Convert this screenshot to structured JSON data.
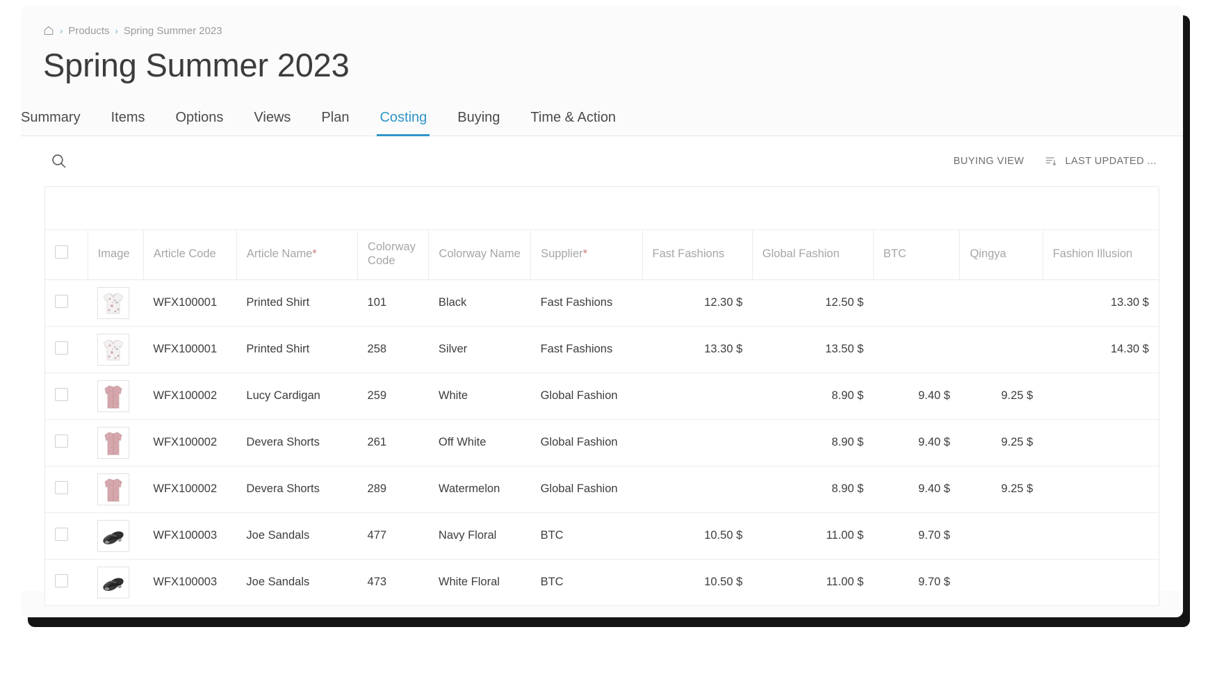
{
  "breadcrumb": {
    "home_icon": "home-icon",
    "items": [
      "Products",
      "Spring Summer 2023"
    ],
    "separator": "›"
  },
  "page_title": "Spring Summer 2023",
  "tabs": [
    {
      "label": "Summary",
      "active": false
    },
    {
      "label": "Items",
      "active": false
    },
    {
      "label": "Options",
      "active": false
    },
    {
      "label": "Views",
      "active": false
    },
    {
      "label": "Plan",
      "active": false
    },
    {
      "label": "Costing",
      "active": true
    },
    {
      "label": "Buying",
      "active": false
    },
    {
      "label": "Time & Action",
      "active": false
    }
  ],
  "toolbar": {
    "search_icon": "search-icon",
    "buying_view_label": "BUYING VIEW",
    "sort_icon": "sort-descending-icon",
    "last_updated_label": "LAST UPDATED ..."
  },
  "table": {
    "headers": {
      "select_all": "",
      "image": "Image",
      "article_code": "Article Code",
      "article_name": "Article Name",
      "article_name_required": "*",
      "colorway_code": "Colorway Code",
      "colorway_name": "Colorway Name",
      "supplier": "Supplier",
      "supplier_required": "*",
      "supplier_cols": [
        "Fast Fashions",
        "Global Fashion",
        "BTC",
        "Qingya",
        "Fashion Illusion"
      ]
    },
    "rows": [
      {
        "image": "shirt-thumbnail",
        "article_code": "WFX100001",
        "article_name": "Printed Shirt",
        "colorway_code": "101",
        "colorway_name": "Black",
        "supplier": "Fast Fashions",
        "prices": [
          "12.30 $",
          "12.50 $",
          "",
          "",
          "13.30 $"
        ],
        "best_index": 0
      },
      {
        "image": "shirt-thumbnail",
        "article_code": "WFX100001",
        "article_name": "Printed Shirt",
        "colorway_code": "258",
        "colorway_name": "Silver",
        "supplier": "Fast Fashions",
        "prices": [
          "13.30 $",
          "13.50 $",
          "",
          "",
          "14.30 $"
        ],
        "best_index": 0
      },
      {
        "image": "cardigan-thumbnail",
        "article_code": "WFX100002",
        "article_name": "Lucy Cardigan",
        "colorway_code": "259",
        "colorway_name": "White",
        "supplier": "Global Fashion",
        "prices": [
          "",
          "8.90 $",
          "9.40 $",
          "9.25 $",
          ""
        ],
        "best_index": 1
      },
      {
        "image": "cardigan-thumbnail",
        "article_code": "WFX100002",
        "article_name": "Devera Shorts",
        "colorway_code": "261",
        "colorway_name": "Off White",
        "supplier": "Global Fashion",
        "prices": [
          "",
          "8.90 $",
          "9.40 $",
          "9.25 $",
          ""
        ],
        "best_index": 1
      },
      {
        "image": "cardigan-thumbnail",
        "article_code": "WFX100002",
        "article_name": "Devera Shorts",
        "colorway_code": "289",
        "colorway_name": "Watermelon",
        "supplier": "Global Fashion",
        "prices": [
          "",
          "8.90 $",
          "9.40 $",
          "9.25 $",
          ""
        ],
        "best_index": 1
      },
      {
        "image": "sandals-thumbnail",
        "article_code": "WFX100003",
        "article_name": "Joe Sandals",
        "colorway_code": "477",
        "colorway_name": "Navy Floral",
        "supplier": "BTC",
        "prices": [
          "10.50 $",
          "11.00 $",
          "9.70 $",
          "",
          ""
        ],
        "best_index": 2
      },
      {
        "image": "sandals-thumbnail",
        "article_code": "WFX100003",
        "article_name": "Joe Sandals",
        "colorway_code": "473",
        "colorway_name": "White Floral",
        "supplier": "BTC",
        "prices": [
          "10.50 $",
          "11.00 $",
          "9.70 $",
          "",
          ""
        ],
        "best_index": 2
      }
    ]
  },
  "colors": {
    "accent": "#2f95c9",
    "best_price": "#2ebd62",
    "required_star": "#d07b7b",
    "muted_text": "#a6a6a6"
  }
}
